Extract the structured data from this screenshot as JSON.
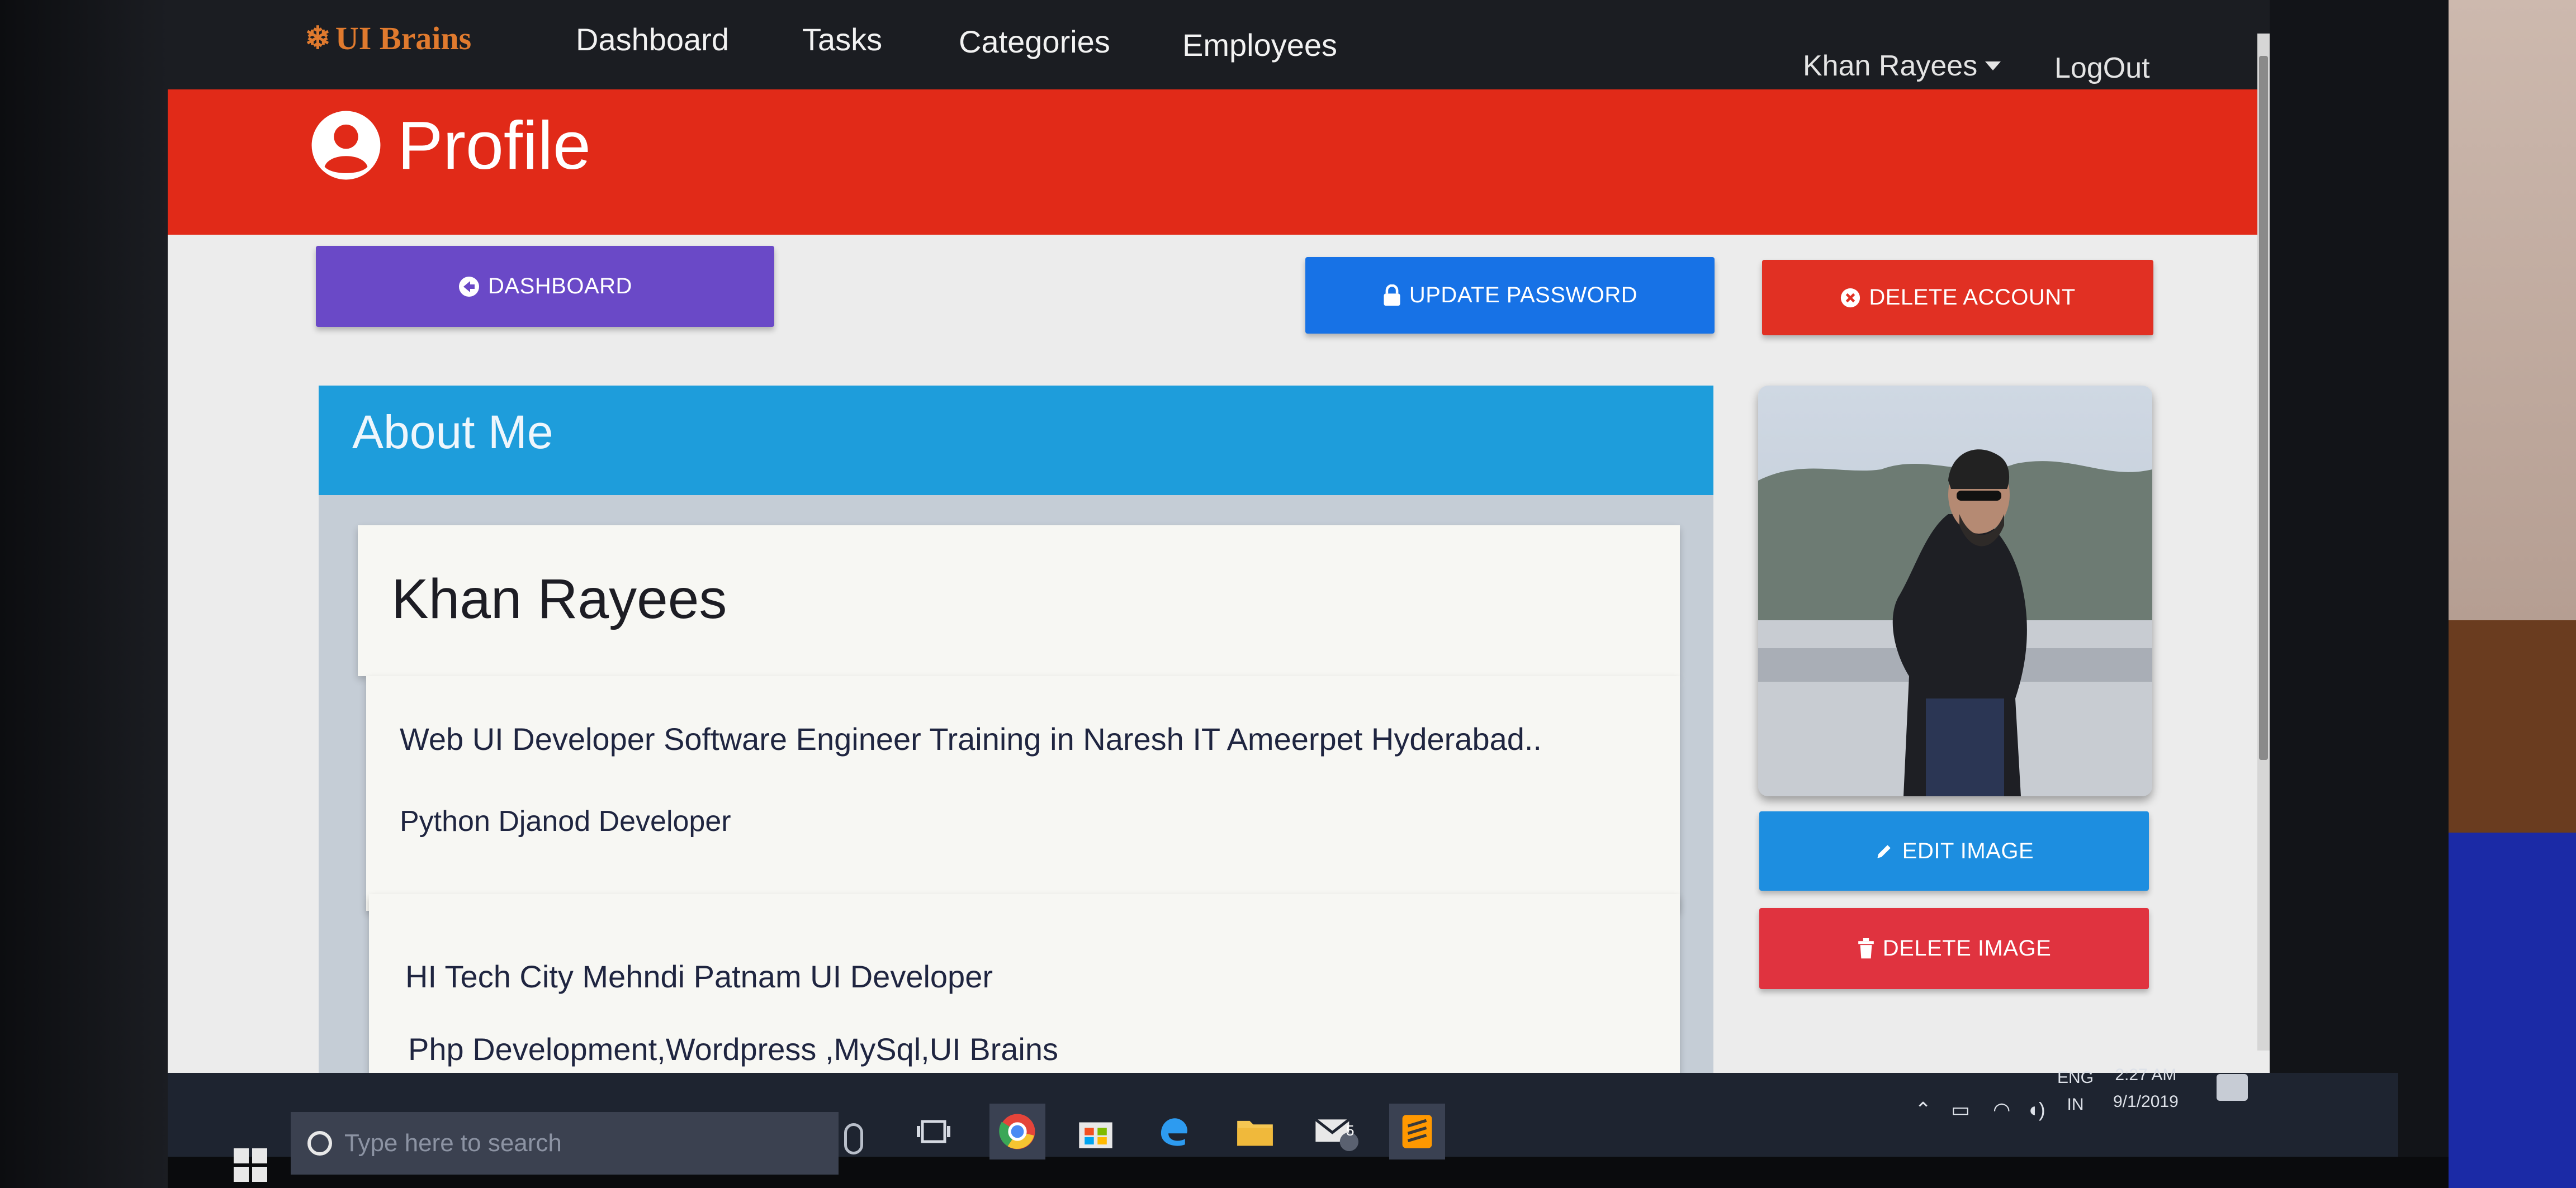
{
  "navbar": {
    "brand": "UI Brains",
    "links": [
      "Dashboard",
      "Tasks",
      "Categories",
      "Employees"
    ],
    "user_menu": "Khan Rayees",
    "logout": "LogOut"
  },
  "page": {
    "title": "Profile"
  },
  "actions": {
    "dashboard": "DASHBOARD",
    "update_password": "UPDATE PASSWORD",
    "delete_account": "DELETE ACCOUNT",
    "edit_image": "EDIT IMAGE",
    "delete_image": "DELETE IMAGE"
  },
  "about": {
    "heading": "About Me",
    "name": "Khan Rayees",
    "lines": [
      "Web UI Developer Software Engineer Training in Naresh IT Ameerpet Hyderabad..",
      "Python Djanod Developer",
      "HI Tech City Mehndi Patnam UI Developer",
      "Php Development,Wordpress ,MySql,UI Brains"
    ]
  },
  "taskbar": {
    "search_placeholder": "Type here to search",
    "mail_badge": "5",
    "language": "ENG",
    "region": "IN",
    "time": "2:27 AM",
    "date": "9/1/2019"
  },
  "colors": {
    "navbar": "#1b1d22",
    "brand": "#e07a2e",
    "profile_band": "#e12a18",
    "dashboard_button": "#6a49c7",
    "update_button": "#1772e6",
    "delete_account_button": "#e13023",
    "about_header": "#1e9ddb",
    "edit_image_button": "#1d8ee0",
    "delete_image_button": "#e0333f"
  }
}
